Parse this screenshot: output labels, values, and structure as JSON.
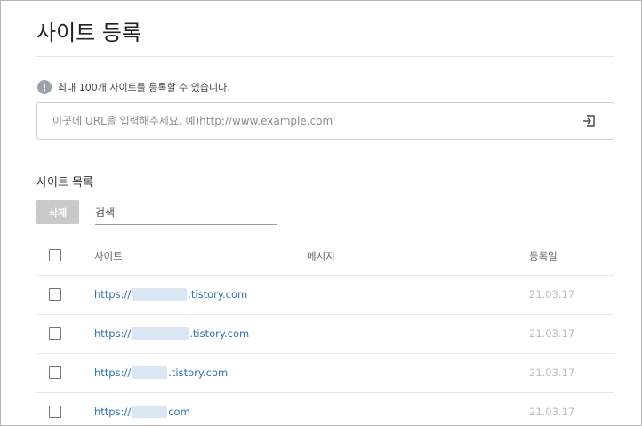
{
  "page": {
    "title": "사이트 등록"
  },
  "notice": {
    "icon": "exclamation-icon",
    "text": "최대 100개 사이트를 등록할 수 있습니다."
  },
  "url_input": {
    "placeholder": "이곳에 URL을 입력해주세요. 예)http://www.example.com",
    "value": ""
  },
  "sites": {
    "title": "사이트 목록",
    "delete_label": "삭제",
    "search_placeholder": "검색",
    "columns": {
      "site": "사이트",
      "message": "메시지",
      "date": "등록일"
    },
    "rows": [
      {
        "prefix": "https://",
        "suffix": ".tistory.com",
        "message": "",
        "date": "21.03.17",
        "checked": false
      },
      {
        "prefix": "https://",
        "suffix": ".tistory.com",
        "message": "",
        "date": "21.03.17",
        "checked": false
      },
      {
        "prefix": "https://",
        "suffix": ".tistory.com",
        "message": "",
        "date": "21.03.17",
        "checked": false
      },
      {
        "prefix": "https://",
        "suffix": "com",
        "message": "",
        "date": "21.03.17",
        "checked": false
      }
    ]
  },
  "colors": {
    "link": "#2f6fb5",
    "date": "#bdbdbd",
    "button_disabled": "#c9c9c9"
  }
}
